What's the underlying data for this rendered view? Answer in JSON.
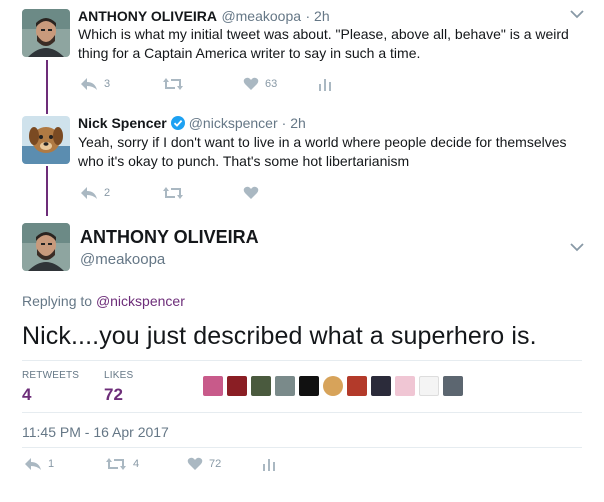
{
  "tweets": [
    {
      "name": "ANTHONY OLIVEIRA",
      "handle": "@meakoopa",
      "time": "· 2h",
      "text_line1": "Which is what my initial tweet was about. \"Please, above all, behave\" is a weird",
      "text_line2": "thing for a Captain America writer to say in such a time.",
      "replies": "3",
      "retweets": "",
      "likes": "63"
    },
    {
      "name": "Nick Spencer",
      "verified": true,
      "handle": "@nickspencer",
      "time": "· 2h",
      "text_line1": "Yeah, sorry if I don't want to live in a world where people decide for themselves",
      "text_line2": "who it's okay to punch. That's some hot libertarianism",
      "replies": "2",
      "retweets": "",
      "likes": ""
    }
  ],
  "main_tweet": {
    "name": "ANTHONY OLIVEIRA",
    "handle": "@meakoopa",
    "replying_label": "Replying to",
    "replying_handle": "@nickspencer",
    "text": "Nick....you just described what a superhero is.",
    "retweets_label": "RETWEETS",
    "retweets_value": "4",
    "likes_label": "LIKES",
    "likes_value": "72",
    "timestamp": "11:45 PM - 16 Apr 2017",
    "replies": "1",
    "retweets": "4",
    "likes": "72"
  },
  "colors": {
    "accent": "#6d2d79",
    "icon_gray": "#aab8c2",
    "verified_blue": "#1da1f2"
  },
  "icons": [
    "reply-icon",
    "retweet-icon",
    "heart-icon",
    "analytics-icon",
    "chevron-down-icon",
    "verified-icon"
  ]
}
